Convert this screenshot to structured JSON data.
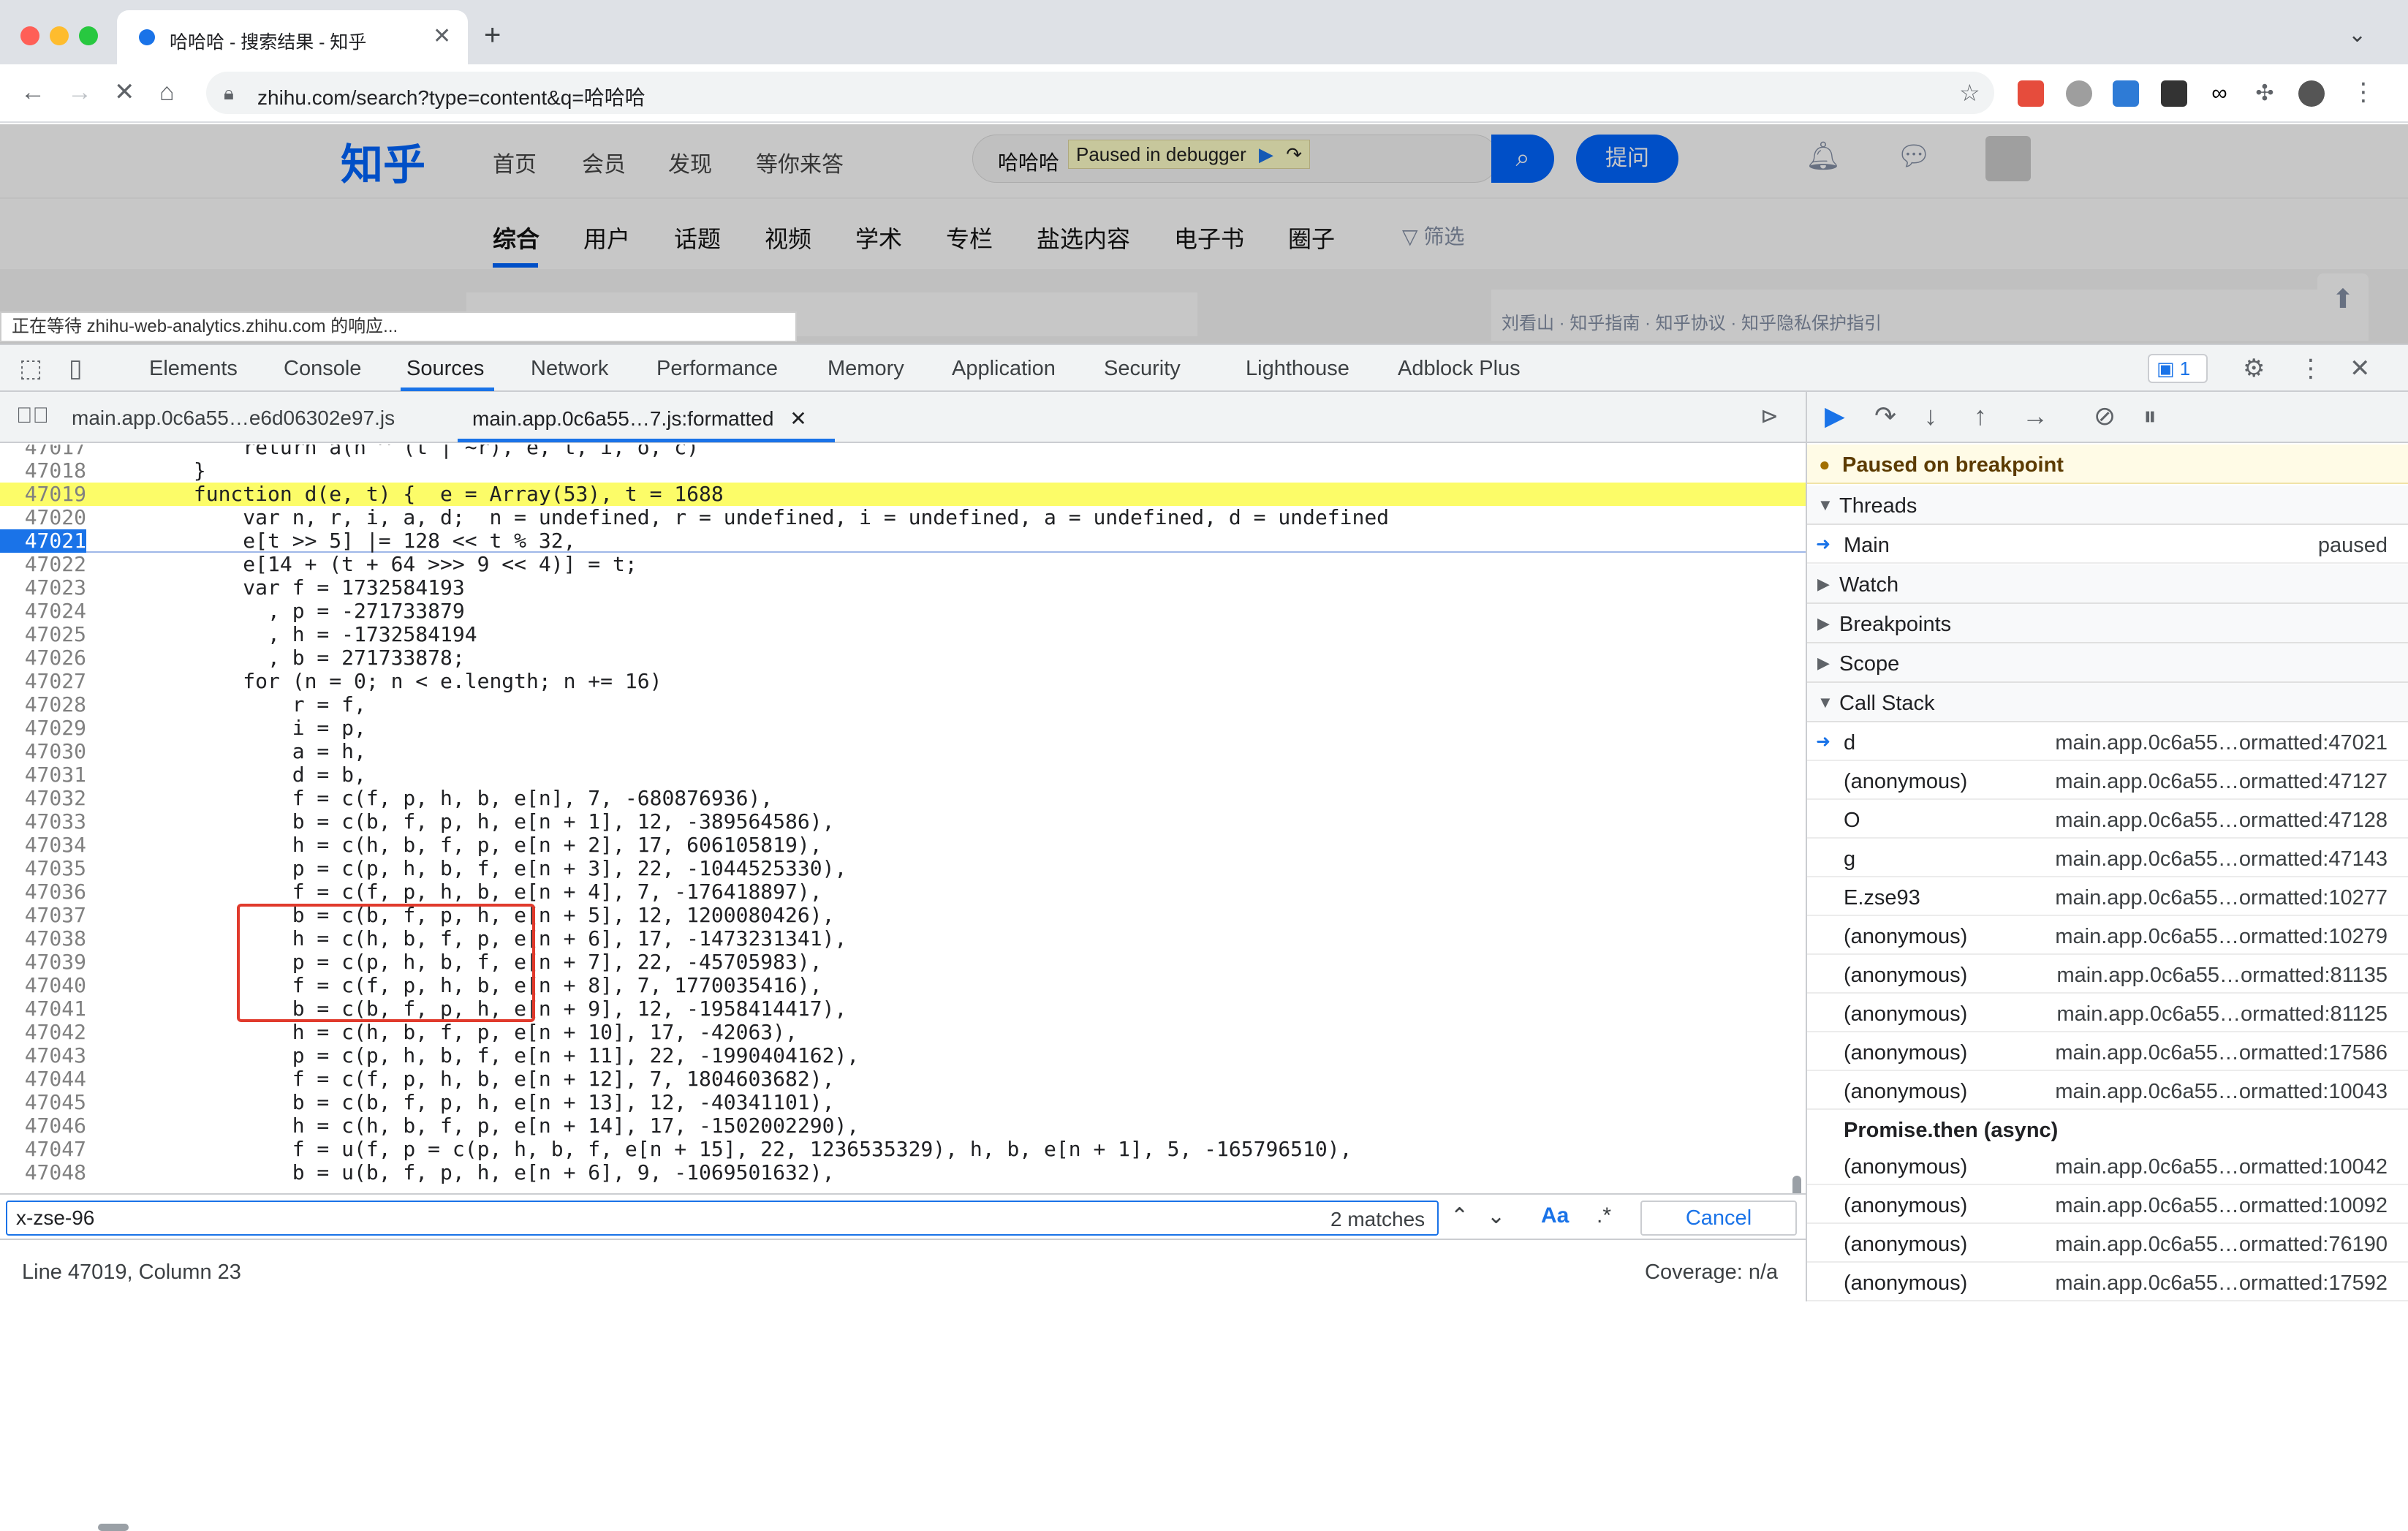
{
  "browser": {
    "tab_title": "哈哈哈 - 搜索结果 - 知乎",
    "url": "zhihu.com/search?type=content&q=哈哈哈",
    "new_tab": "+",
    "tab_close": "✕"
  },
  "zhihu": {
    "logo": "知乎",
    "nav": [
      "首页",
      "会员",
      "发现",
      "等你来答"
    ],
    "search_query": "哈哈哈",
    "debugger_pill": "Paused in debugger",
    "ask_button": "提问",
    "subtabs": [
      "综合",
      "用户",
      "话题",
      "视频",
      "学术",
      "专栏",
      "盐选内容",
      "电子书",
      "圈子"
    ],
    "filter": "筛选",
    "status_tip": "正在等待 zhihu-web-analytics.zhihu.com 的响应...",
    "footer": "刘看山 · 知乎指南 · 知乎协议 · 知乎隐私保护指引"
  },
  "devtools": {
    "tabs": [
      "Elements",
      "Console",
      "Sources",
      "Network",
      "Performance",
      "Memory",
      "Application",
      "Security",
      "Lighthouse",
      "Adblock Plus"
    ],
    "active_tab": "Sources",
    "issues_count": "1",
    "file_tabs": [
      "main.app.0c6a55…e6d06302e97.js",
      "main.app.0c6a55…7.js:formatted"
    ],
    "code_lines": [
      {
        "n": "47017",
        "code": "            return a(n ^ (t | ~r), e, t, i, o, c)"
      },
      {
        "n": "47018",
        "code": "        }"
      },
      {
        "n": "47019",
        "code": "        function d(e, t) {  e = Array(53), t = 1688",
        "hl": true
      },
      {
        "n": "47020",
        "code": "            var n, r, i, a, d;  n = undefined, r = undefined, i = undefined, a = undefined, d = undefined"
      },
      {
        "n": "47021",
        "code": "            e[t >> 5] |= 128 << t % 32,",
        "current": true
      },
      {
        "n": "47022",
        "code": "            e[14 + (t + 64 >>> 9 << 4)] = t;"
      },
      {
        "n": "47023",
        "code": "            var f = 1732584193"
      },
      {
        "n": "47024",
        "code": "              , p = -271733879"
      },
      {
        "n": "47025",
        "code": "              , h = -1732584194"
      },
      {
        "n": "47026",
        "code": "              , b = 271733878;"
      },
      {
        "n": "47027",
        "code": "            for (n = 0; n < e.length; n += 16)"
      },
      {
        "n": "47028",
        "code": "                r = f,"
      },
      {
        "n": "47029",
        "code": "                i = p,"
      },
      {
        "n": "47030",
        "code": "                a = h,"
      },
      {
        "n": "47031",
        "code": "                d = b,"
      },
      {
        "n": "47032",
        "code": "                f = c(f, p, h, b, e[n], 7, -680876936),"
      },
      {
        "n": "47033",
        "code": "                b = c(b, f, p, h, e[n + 1], 12, -389564586),"
      },
      {
        "n": "47034",
        "code": "                h = c(h, b, f, p, e[n + 2], 17, 606105819),"
      },
      {
        "n": "47035",
        "code": "                p = c(p, h, b, f, e[n + 3], 22, -1044525330),"
      },
      {
        "n": "47036",
        "code": "                f = c(f, p, h, b, e[n + 4], 7, -176418897),"
      },
      {
        "n": "47037",
        "code": "                b = c(b, f, p, h, e[n + 5], 12, 1200080426),"
      },
      {
        "n": "47038",
        "code": "                h = c(h, b, f, p, e[n + 6], 17, -1473231341),"
      },
      {
        "n": "47039",
        "code": "                p = c(p, h, b, f, e[n + 7], 22, -45705983),"
      },
      {
        "n": "47040",
        "code": "                f = c(f, p, h, b, e[n + 8], 7, 1770035416),"
      },
      {
        "n": "47041",
        "code": "                b = c(b, f, p, h, e[n + 9], 12, -1958414417),"
      },
      {
        "n": "47042",
        "code": "                h = c(h, b, f, p, e[n + 10], 17, -42063),"
      },
      {
        "n": "47043",
        "code": "                p = c(p, h, b, f, e[n + 11], 22, -1990404162),"
      },
      {
        "n": "47044",
        "code": "                f = c(f, p, h, b, e[n + 12], 7, 1804603682),"
      },
      {
        "n": "47045",
        "code": "                b = c(b, f, p, h, e[n + 13], 12, -40341101),"
      },
      {
        "n": "47046",
        "code": "                h = c(h, b, f, p, e[n + 14], 17, -1502002290),"
      },
      {
        "n": "47047",
        "code": "                f = u(f, p = c(p, h, b, f, e[n + 15], 22, 1236535329), h, b, e[n + 1], 5, -165796510),"
      },
      {
        "n": "47048",
        "code": "                b = u(b, f, p, h, e[n + 6], 9, -1069501632),"
      }
    ],
    "search_value": "x-zse-96",
    "match_count": "2 matches",
    "match_case": "Aa",
    "regex": ".*",
    "cancel": "Cancel",
    "status_left": "Line 47019, Column 23",
    "status_right": "Coverage: n/a",
    "paused_text": "Paused on breakpoint",
    "sections": {
      "threads": "Threads",
      "watch": "Watch",
      "breakpoints": "Breakpoints",
      "scope": "Scope",
      "call_stack": "Call Stack"
    },
    "thread_main": "Main",
    "thread_status": "paused",
    "call_stack": [
      {
        "fn": "d",
        "loc": "main.app.0c6a55…ormatted:47021",
        "current": true
      },
      {
        "fn": "(anonymous)",
        "loc": "main.app.0c6a55…ormatted:47127"
      },
      {
        "fn": "O",
        "loc": "main.app.0c6a55…ormatted:47128"
      },
      {
        "fn": "g",
        "loc": "main.app.0c6a55…ormatted:47143"
      },
      {
        "fn": "E.zse93",
        "loc": "main.app.0c6a55…ormatted:10277"
      },
      {
        "fn": "(anonymous)",
        "loc": "main.app.0c6a55…ormatted:10279"
      },
      {
        "fn": "(anonymous)",
        "loc": "main.app.0c6a55…ormatted:81135"
      },
      {
        "fn": "(anonymous)",
        "loc": "main.app.0c6a55…ormatted:81125"
      },
      {
        "fn": "(anonymous)",
        "loc": "main.app.0c6a55…ormatted:17586"
      },
      {
        "fn": "(anonymous)",
        "loc": "main.app.0c6a55…ormatted:10043"
      }
    ],
    "async_label": "Promise.then (async)",
    "async_stack": [
      {
        "fn": "(anonymous)",
        "loc": "main.app.0c6a55…ormatted:10042"
      },
      {
        "fn": "(anonymous)",
        "loc": "main.app.0c6a55…ormatted:10092"
      },
      {
        "fn": "(anonymous)",
        "loc": "main.app.0c6a55…ormatted:76190"
      },
      {
        "fn": "(anonymous)",
        "loc": "main.app.0c6a55…ormatted:17592"
      }
    ]
  },
  "colors": {
    "accent": "#1a73e8",
    "zhihu_blue": "#0066ff",
    "breakpoint_line": "#fcfc68",
    "highlight_box": "#e03a2c"
  }
}
